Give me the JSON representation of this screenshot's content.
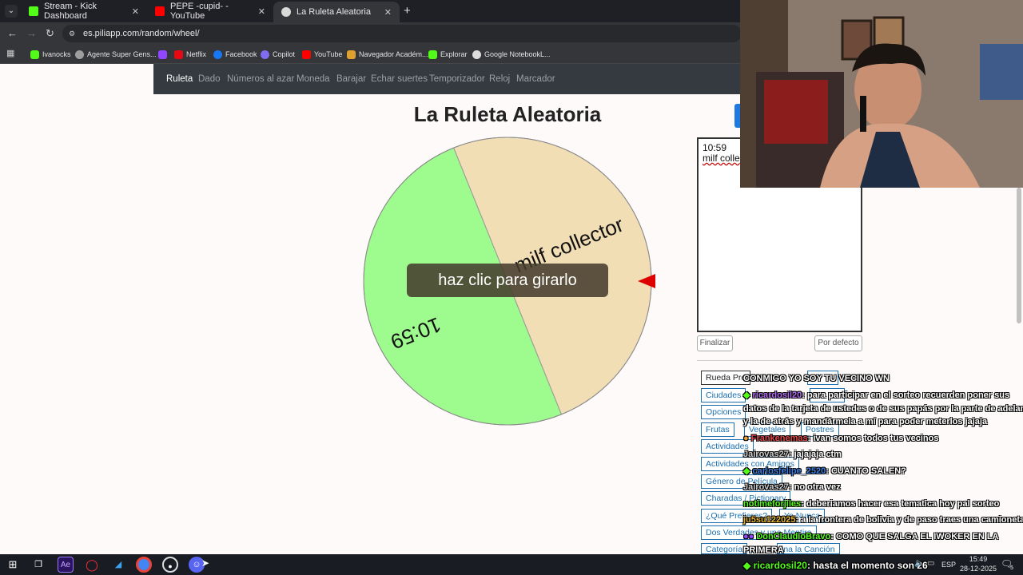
{
  "tabs": [
    {
      "label": "Stream - Kick Dashboard",
      "icon": "kick-icon",
      "color": "#53fc18"
    },
    {
      "label": "PEPE -cupid- - YouTube",
      "icon": "youtube-icon",
      "color": "#ff0000"
    },
    {
      "label": "La Ruleta Aleatoria",
      "icon": "piliapp-icon",
      "color": "#d9d9d9"
    }
  ],
  "address": {
    "url": "es.piliapp.com/random/wheel/"
  },
  "bookmarks": [
    {
      "label": "Ivanocks",
      "icon": "kick-icon",
      "color": "#53fc18"
    },
    {
      "label": "Agente Super Gens...",
      "icon": "agent-icon",
      "color": "#9e9e9e"
    },
    {
      "label": "",
      "icon": "twitch-icon",
      "color": "#9146ff"
    },
    {
      "label": "Netflix",
      "icon": "netflix-icon",
      "color": "#e50914"
    },
    {
      "label": "Facebook",
      "icon": "facebook-icon",
      "color": "#1877f2"
    },
    {
      "label": "Copilot",
      "icon": "copilot-icon",
      "color": "#7f6cf0"
    },
    {
      "label": "YouTube",
      "icon": "youtube-icon",
      "color": "#ff0000"
    },
    {
      "label": "Navegador Académ...",
      "icon": "academic-icon",
      "color": "#e0a030"
    },
    {
      "label": "Explorar",
      "icon": "kick-icon",
      "color": "#53fc18"
    },
    {
      "label": "Google NotebookL...",
      "icon": "notebook-icon",
      "color": "#dddddd"
    }
  ],
  "site_nav": [
    "Ruleta",
    "Dado",
    "Números al azar",
    "Moneda",
    "Barajar",
    "Echar suertes",
    "Temporizador",
    "Reloj",
    "Marcador"
  ],
  "page": {
    "title": "La Ruleta Aleatoria",
    "spin_button": "haz clic para girarlo"
  },
  "wheel": {
    "segments": [
      {
        "label": "milf collector",
        "color": "#f2deb5"
      },
      {
        "label": "10:59",
        "color": "#9efb8e"
      }
    ],
    "pointer_color": "#dd0000"
  },
  "editor": {
    "line1": "10:59",
    "line2": "milf colle",
    "finish_label": "Finalizar",
    "default_label": "Por defecto"
  },
  "presets": [
    "Rueda Pre",
    "Ciudades",
    "Opciones",
    "Frutas",
    "Vegetales",
    "Postres",
    "Actividades",
    "Actividades con Amigos",
    "Género de Película",
    "Charadas / Pictionary",
    "¿Qué Prefieres?",
    "Yo Nunca",
    "Dos Verdades y una Mentira",
    "Categoría",
    "ina la Canción"
  ],
  "chat": [
    {
      "user": "",
      "text": "CONMIGO YO SOY TU VECINO WN"
    },
    {
      "user": "ricardosil20",
      "text": ": para participar en el sorteo recuerden poner sus"
    },
    {
      "user": "",
      "text": "datos de la tarjeta de ustedes o de sus papás por la parte de adelante"
    },
    {
      "user": "",
      "text": "y la de atrás y mandármela a mí para poder meterlos jajaja"
    },
    {
      "user": "Frankenemas",
      "text": ": ivan somos todos tus vecinos"
    },
    {
      "user": "Jairovas27",
      "text": ": jajajaja ctm"
    },
    {
      "user": "carlosfelipe_2520",
      "text": ": CUANTO SALEN?"
    },
    {
      "user": "Jairovas27",
      "text": ": no otra vez"
    },
    {
      "user": "notimeforjiles",
      "text": ": deberiamos hacer esa tematica hoy pal sorteo"
    },
    {
      "user": "ju5su122025",
      "text": ": a la frontera de bolivia y de paso traes una camioneta"
    },
    {
      "user": "DonClaudioBravo",
      "text": ": COMO QUE SALGA EL IWOKER EN LA"
    },
    {
      "user": "",
      "text": "PRIMERA"
    }
  ],
  "taskbar_chat": {
    "user": "ricardosil20",
    "text": ": hasta el momento son 26"
  },
  "tray": {
    "lang": "ESP",
    "time": "15:49",
    "date": "28-12-2025",
    "notif": "5"
  }
}
